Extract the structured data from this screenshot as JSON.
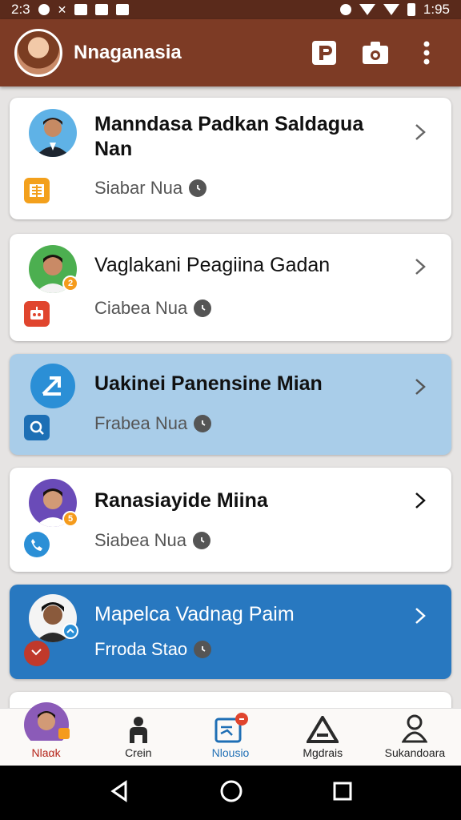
{
  "status_bar": {
    "time_left": "2:3",
    "time_right": "1:95"
  },
  "app_bar": {
    "title": "Nnaganasia"
  },
  "contacts": [
    {
      "name": "Manndasa Padkan Saldagua Nan",
      "sub": "Siabar Nua",
      "highlight": "none",
      "badge": "",
      "small_icon": "notes-icon",
      "small_icon_color": "#f3a01c"
    },
    {
      "name": "Vaglakani Peagiina Gadan",
      "sub": "Ciabea Nua",
      "highlight": "none",
      "badge": "2",
      "small_icon": "robot-icon",
      "small_icon_color": "#e0452e"
    },
    {
      "name": "Uakinei Panensine Mian",
      "sub": "Frabea Nua",
      "highlight": "light",
      "badge": "",
      "small_icon": "search-icon",
      "small_icon_color": "#1d6fb5"
    },
    {
      "name": "Ranasiayide Miina",
      "sub": "Siabea Nua",
      "highlight": "none",
      "badge": "5",
      "small_icon": "phone-icon",
      "small_icon_color": "#2b8fd6"
    },
    {
      "name": "Mapelca Vadnag Paim",
      "sub": "Frroda Stao",
      "highlight": "dark",
      "badge": "",
      "small_icon": "missed-call-icon",
      "small_icon_color": "#c0392b"
    }
  ],
  "bottom_nav": [
    {
      "label": "Nlaαk",
      "icon": "profile-avatar-icon",
      "state": "profile"
    },
    {
      "label": "Crein",
      "icon": "person-icon",
      "state": "normal"
    },
    {
      "label": "Nlousio",
      "icon": "chat-icon",
      "state": "active"
    },
    {
      "label": "Mgdrais",
      "icon": "triangle-a-icon",
      "state": "normal"
    },
    {
      "label": "Sukandoara",
      "icon": "user-icon",
      "state": "normal"
    }
  ],
  "colors": {
    "app_bar": "#7d3b25",
    "accent": "#1f6fb5",
    "highlight_dark": "#2878c0",
    "highlight_light": "#a9cde9"
  }
}
